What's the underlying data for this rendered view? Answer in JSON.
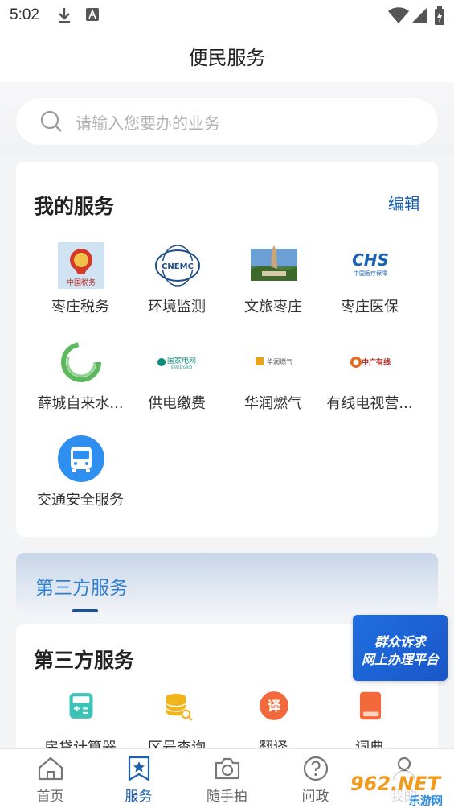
{
  "status_bar": {
    "time": "5:02"
  },
  "header": {
    "title": "便民服务"
  },
  "search": {
    "placeholder": "请输入您要办的业务"
  },
  "my_services": {
    "title": "我的服务",
    "edit_label": "编辑",
    "items": [
      {
        "label": "枣庄税务",
        "icon": "tax-emblem-icon"
      },
      {
        "label": "环境监测",
        "icon": "cnemc-logo-icon"
      },
      {
        "label": "文旅枣庄",
        "icon": "tourism-photo-icon"
      },
      {
        "label": "枣庄医保",
        "icon": "chs-logo-icon"
      },
      {
        "label": "薛城自来水...",
        "icon": "water-logo-icon"
      },
      {
        "label": "供电缴费",
        "icon": "state-grid-logo-icon"
      },
      {
        "label": "华润燃气",
        "icon": "cr-gas-logo-icon"
      },
      {
        "label": "有线电视营...",
        "icon": "china-cable-logo-icon"
      },
      {
        "label": "交通安全服务",
        "icon": "bus-icon"
      }
    ]
  },
  "third_party_tab": {
    "label": "第三方服务"
  },
  "third_party": {
    "title": "第三方服务",
    "items": [
      {
        "label": "房贷计算器",
        "icon": "calculator-icon"
      },
      {
        "label": "区号查询",
        "icon": "database-search-icon"
      },
      {
        "label": "翻译",
        "icon": "translate-icon",
        "glyph": "译"
      },
      {
        "label": "词典",
        "icon": "dictionary-icon"
      }
    ]
  },
  "banner": {
    "line1": "群众诉求",
    "line2": "网上办理平台"
  },
  "logo_text": {
    "tax": "中国税务",
    "cnemc": "CNEMC",
    "chs": "CHS",
    "chs_sub": "中国医疗保障",
    "state_grid": "国家电网",
    "state_grid_en": "STATE GRID",
    "cr_gas": "华润燃气",
    "china_cable": "中广有线"
  },
  "bottom_nav": [
    {
      "label": "首页",
      "icon": "home-icon"
    },
    {
      "label": "服务",
      "icon": "star-bookmark-icon",
      "active": true
    },
    {
      "label": "随手拍",
      "icon": "camera-icon"
    },
    {
      "label": "问政",
      "icon": "question-icon"
    },
    {
      "label": "我的",
      "icon": "user-icon"
    }
  ],
  "watermark": {
    "text": "962.NET",
    "subtext": "乐游网"
  },
  "colors": {
    "accent": "#1a5fb4",
    "tab_blue": "#2f7fd0",
    "background": "#f3f4f6"
  }
}
